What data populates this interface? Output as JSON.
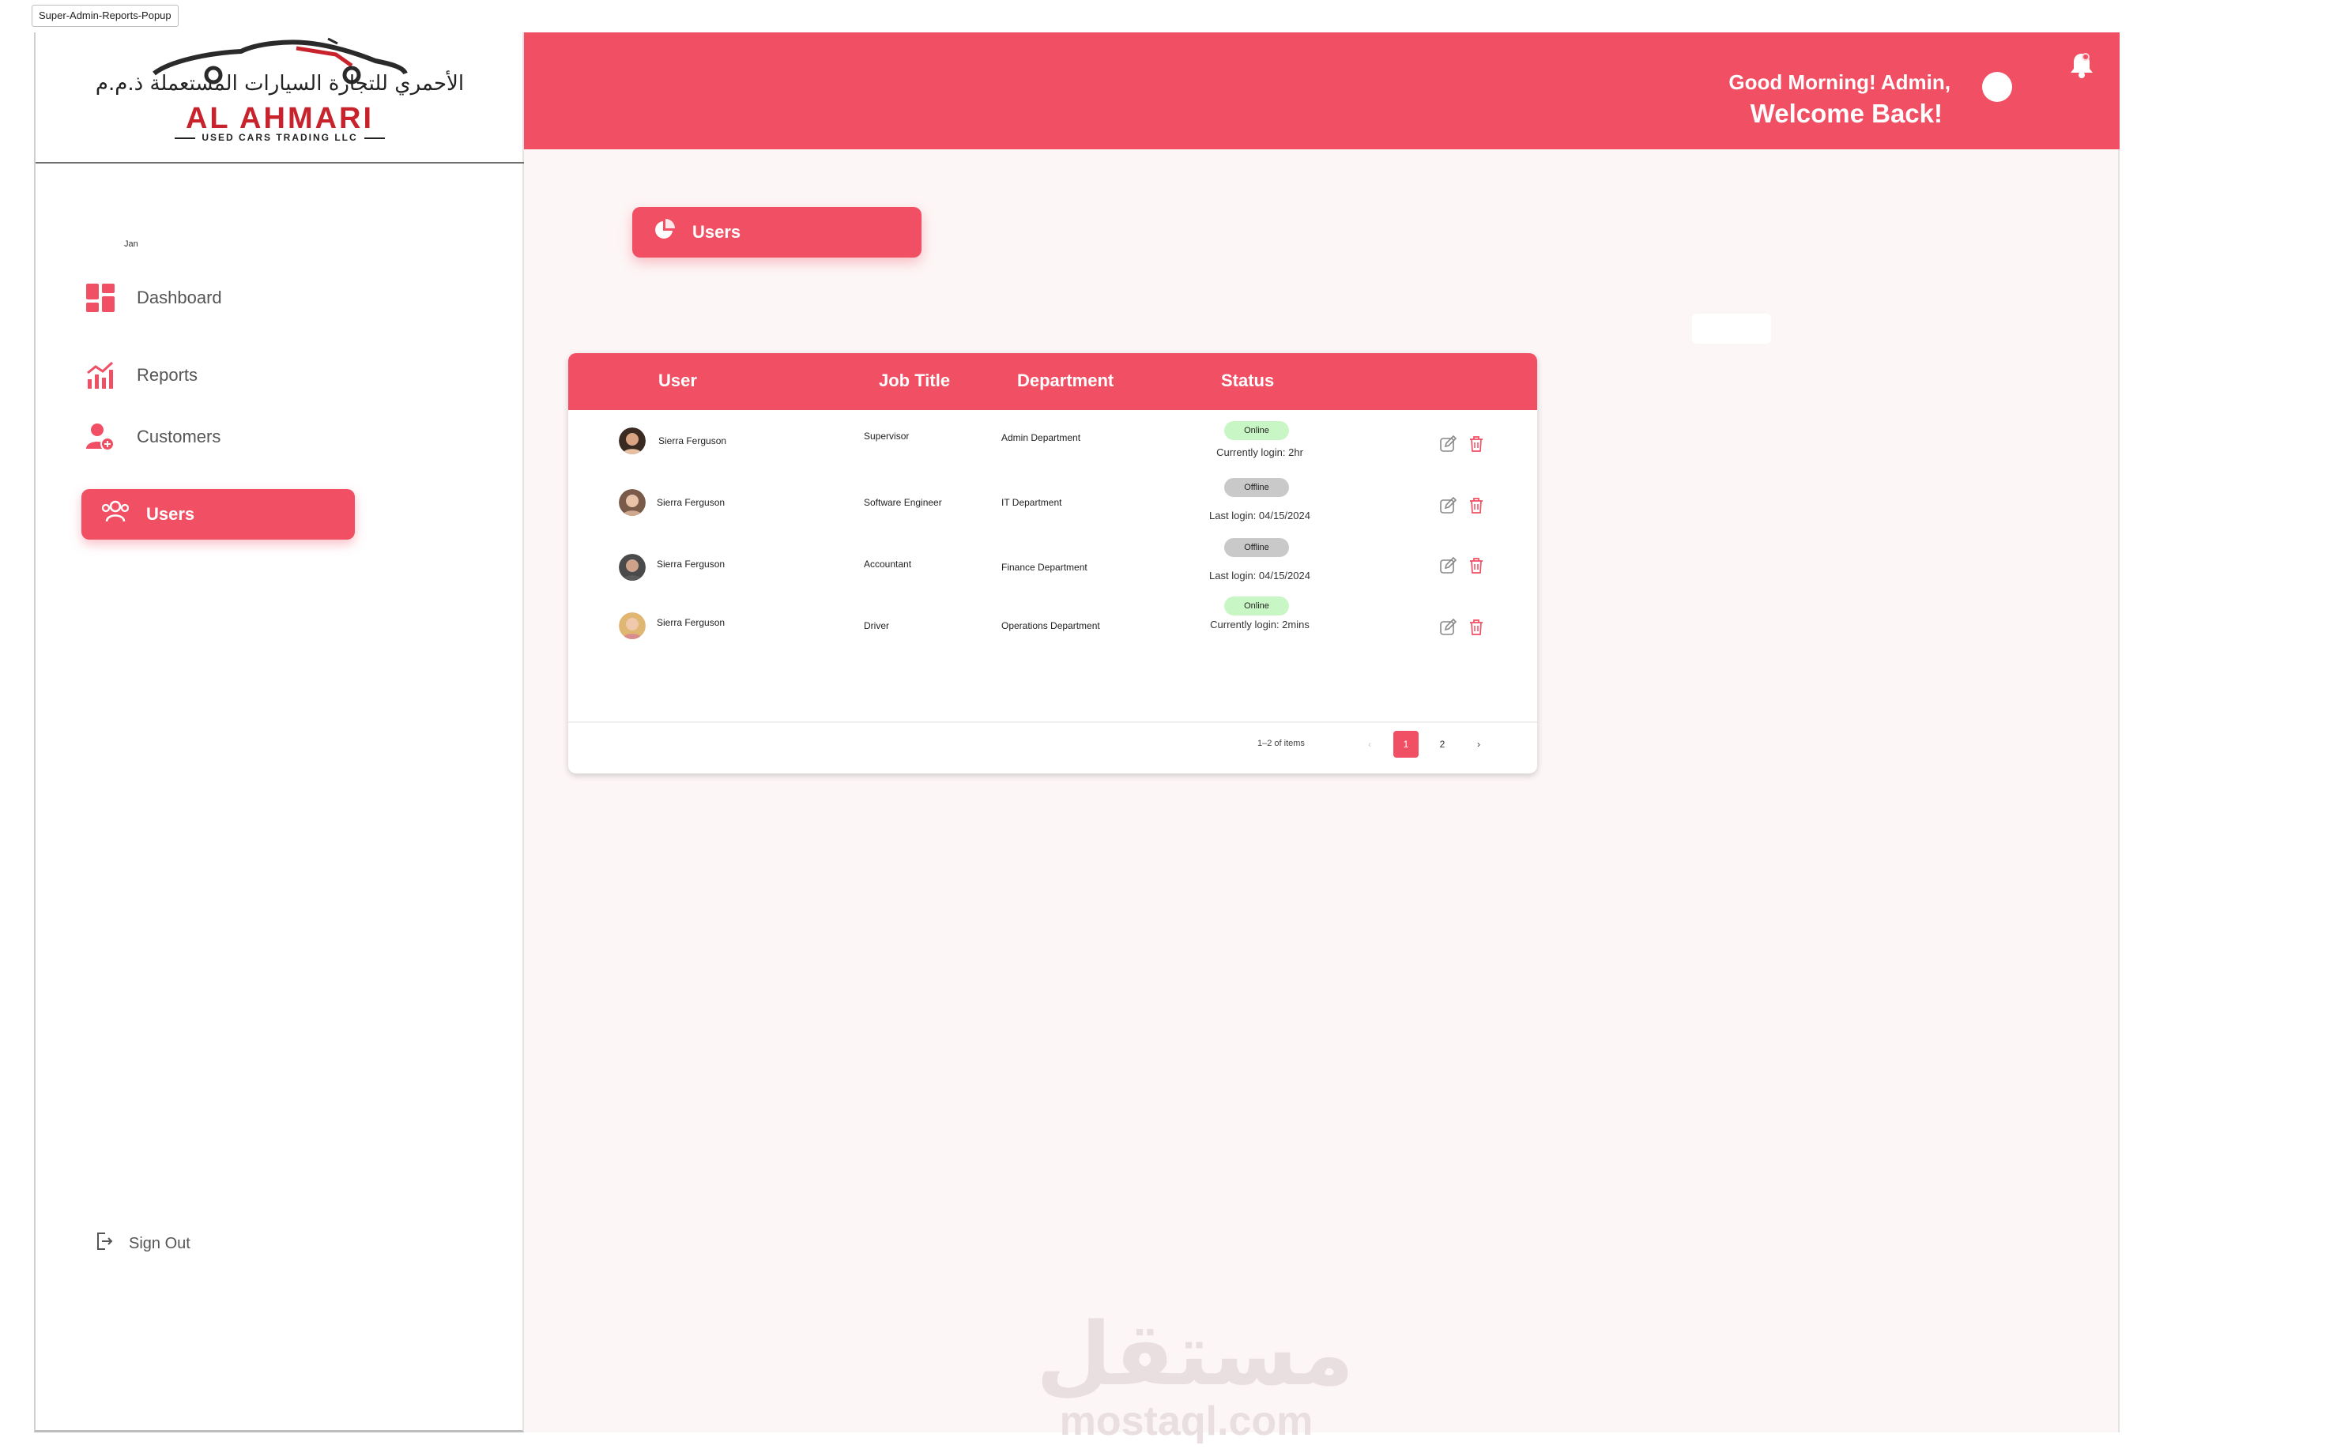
{
  "frame": {
    "label": "Super-Admin-Reports-Popup"
  },
  "brand": {
    "arabic": "الأحمري للتجارة السيارات المستعملة ذ.م.م",
    "name": "AL AHMARI",
    "sub": "USED CARS TRADING LLC",
    "accent": "#f14f63"
  },
  "sidebar": {
    "user_mini": "Jan",
    "items": [
      {
        "label": "Dashboard",
        "icon": "dashboard-icon"
      },
      {
        "label": "Reports",
        "icon": "chart-icon"
      },
      {
        "label": "Customers",
        "icon": "customers-icon"
      },
      {
        "label": "Users",
        "icon": "users-icon",
        "active": true
      }
    ],
    "signout": "Sign Out"
  },
  "header": {
    "greeting": "Good Morning!  Admin,",
    "welcome": "Welcome Back!",
    "notifications_icon": "bell-icon"
  },
  "page": {
    "button_label": "Users",
    "button_icon": "pie-chart-icon"
  },
  "table": {
    "columns": [
      "User",
      "Job Title",
      "Department",
      "Status"
    ],
    "rows": [
      {
        "user": "Sierra Ferguson",
        "job": "Supervisor",
        "dept": "Admin Department",
        "status": "Online",
        "sub": "Currently login: 2hr"
      },
      {
        "user": "Sierra Ferguson",
        "job": "Software Engineer",
        "dept": "IT Department",
        "status": "Offline",
        "sub": "Last login: 04/15/2024"
      },
      {
        "user": "Sierra Ferguson",
        "job": "Accountant",
        "dept": "Finance Department",
        "status": "Offline",
        "sub": "Last login: 04/15/2024"
      },
      {
        "user": "Sierra Ferguson",
        "job": "Driver",
        "dept": "Operations Department",
        "status": "Online",
        "sub": "Currently login: 2mins"
      }
    ],
    "pager": {
      "info": "1–2 of items",
      "pages": [
        "1",
        "2"
      ],
      "prev": "‹",
      "next": "›"
    }
  },
  "watermark": {
    "arabic": "مستقل",
    "latin": "mostaql.com"
  }
}
